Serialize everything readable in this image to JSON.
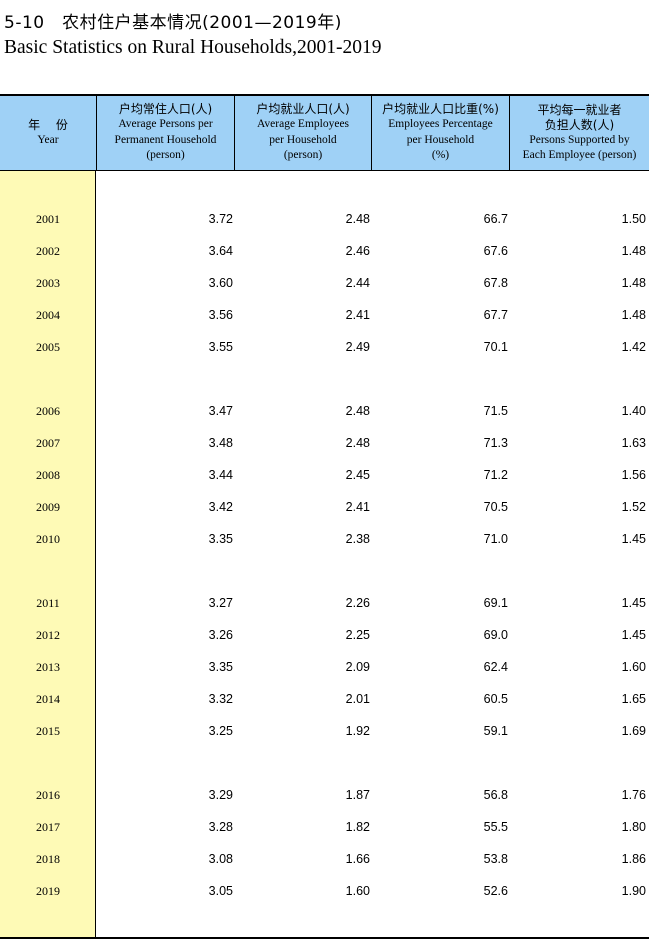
{
  "title": {
    "cn": "5-10　农村住户基本情况(2001—2019年)",
    "en": "Basic Statistics on Rural Households,2001-2019"
  },
  "headers": [
    {
      "cn": "年  份",
      "en": [
        "Year"
      ]
    },
    {
      "cn": "户均常住人口(人)",
      "en": [
        "Average Persons per",
        "Permanent Household",
        "(person)"
      ]
    },
    {
      "cn": "户均就业人口(人)",
      "en": [
        "Average Employees",
        "per Household",
        "(person)"
      ]
    },
    {
      "cn": "户均就业人口比重(%)",
      "en": [
        "Employees Percentage",
        "per Household",
        "(%)"
      ]
    },
    {
      "cn": "平均每一就业者\n负担人数(人)",
      "en": [
        "Persons Supported by",
        "Each Employee (person)"
      ]
    }
  ],
  "rows": [
    {
      "year": "2001",
      "persons": "3.72",
      "employees": "2.48",
      "pct": "66.7",
      "supported": "1.50"
    },
    {
      "year": "2002",
      "persons": "3.64",
      "employees": "2.46",
      "pct": "67.6",
      "supported": "1.48"
    },
    {
      "year": "2003",
      "persons": "3.60",
      "employees": "2.44",
      "pct": "67.8",
      "supported": "1.48"
    },
    {
      "year": "2004",
      "persons": "3.56",
      "employees": "2.41",
      "pct": "67.7",
      "supported": "1.48"
    },
    {
      "year": "2005",
      "persons": "3.55",
      "employees": "2.49",
      "pct": "70.1",
      "supported": "1.42"
    },
    {
      "year": "2006",
      "persons": "3.47",
      "employees": "2.48",
      "pct": "71.5",
      "supported": "1.40"
    },
    {
      "year": "2007",
      "persons": "3.48",
      "employees": "2.48",
      "pct": "71.3",
      "supported": "1.63"
    },
    {
      "year": "2008",
      "persons": "3.44",
      "employees": "2.45",
      "pct": "71.2",
      "supported": "1.56"
    },
    {
      "year": "2009",
      "persons": "3.42",
      "employees": "2.41",
      "pct": "70.5",
      "supported": "1.52"
    },
    {
      "year": "2010",
      "persons": "3.35",
      "employees": "2.38",
      "pct": "71.0",
      "supported": "1.45"
    },
    {
      "year": "2011",
      "persons": "3.27",
      "employees": "2.26",
      "pct": "69.1",
      "supported": "1.45"
    },
    {
      "year": "2012",
      "persons": "3.26",
      "employees": "2.25",
      "pct": "69.0",
      "supported": "1.45"
    },
    {
      "year": "2013",
      "persons": "3.35",
      "employees": "2.09",
      "pct": "62.4",
      "supported": "1.60"
    },
    {
      "year": "2014",
      "persons": "3.32",
      "employees": "2.01",
      "pct": "60.5",
      "supported": "1.65"
    },
    {
      "year": "2015",
      "persons": "3.25",
      "employees": "1.92",
      "pct": "59.1",
      "supported": "1.69"
    },
    {
      "year": "2016",
      "persons": "3.29",
      "employees": "1.87",
      "pct": "56.8",
      "supported": "1.76"
    },
    {
      "year": "2017",
      "persons": "3.28",
      "employees": "1.82",
      "pct": "55.5",
      "supported": "1.80"
    },
    {
      "year": "2018",
      "persons": "3.08",
      "employees": "1.66",
      "pct": "53.8",
      "supported": "1.86"
    },
    {
      "year": "2019",
      "persons": "3.05",
      "employees": "1.60",
      "pct": "52.6",
      "supported": "1.90"
    }
  ]
}
